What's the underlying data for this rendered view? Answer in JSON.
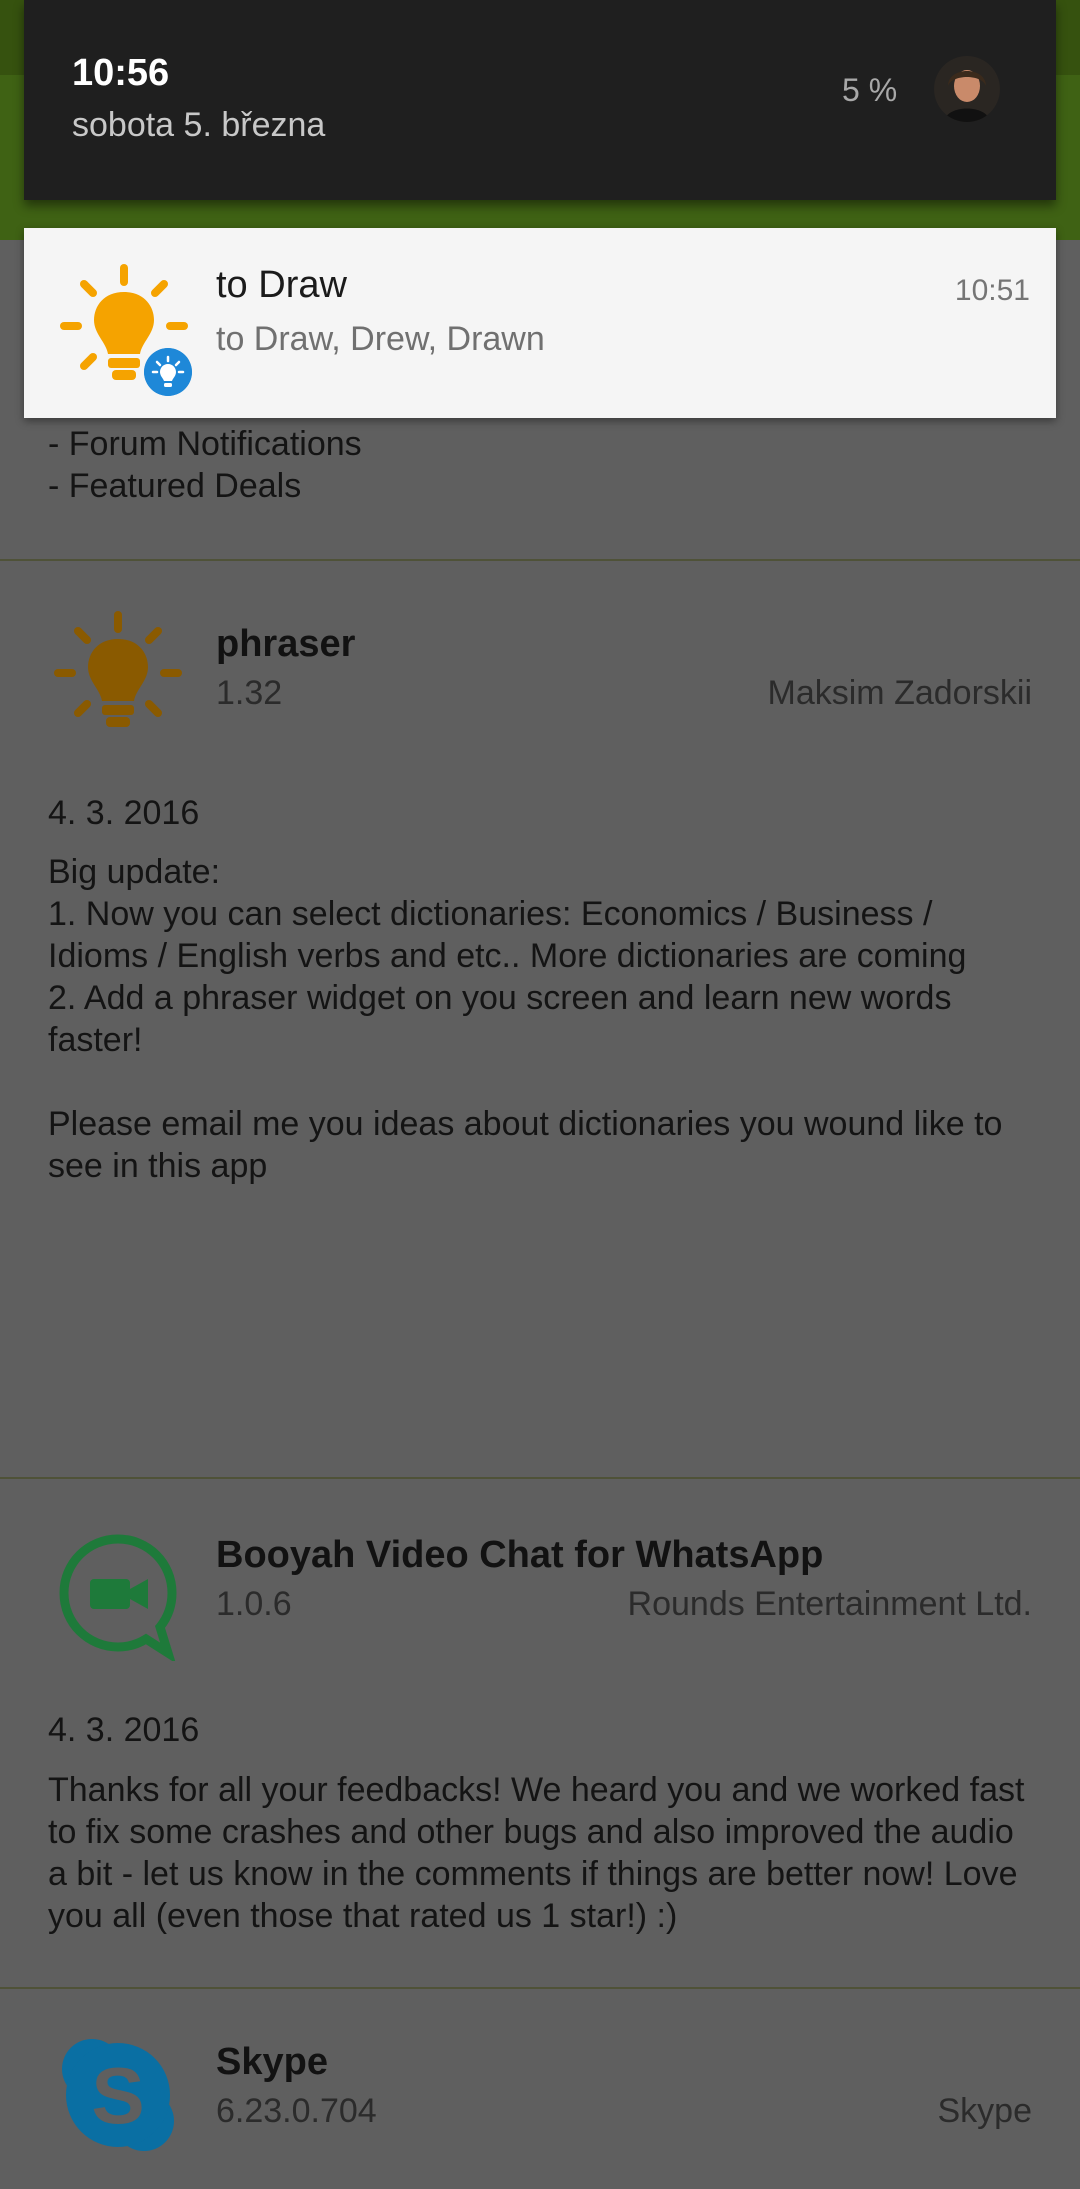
{
  "shade": {
    "time": "10:56",
    "date": "sobota 5. března",
    "battery": "5 %",
    "avatar_icon": "user-avatar"
  },
  "notification": {
    "icon": "lightbulb-icon",
    "badge_icon": "lightbulb-badge-icon",
    "title": "to Draw",
    "text": "to Draw, Drew, Drawn",
    "time": "10:51"
  },
  "previous_entry": {
    "lines": [
      "- Forum Notifications",
      "- Featured Deals"
    ]
  },
  "apps": [
    {
      "name": "phraser",
      "version": "1.32",
      "developer": "Maksim Zadorskii",
      "date": "4. 3. 2016",
      "notes": "Big update:\n1. Now you can select dictionaries: Economics / Business / Idioms / English verbs and etc.. More dictionaries are coming\n2. Add a phraser widget on you screen and learn new words faster!\n\nPlease email me you ideas about dictionaries you wound like to see in this app",
      "icon": "lightbulb-icon"
    },
    {
      "name": "Booyah Video Chat for WhatsApp",
      "version": "1.0.6",
      "developer": "Rounds Entertainment Ltd.",
      "date": "4. 3. 2016",
      "notes": "Thanks for all your feedbacks! We heard you and we worked fast to fix some crashes and other bugs and also improved the audio a bit - let us know in the comments if things are better now! Love you all (even those that rated us 1 star!) :)",
      "icon": "video-chat-icon"
    },
    {
      "name": "Skype",
      "version": "6.23.0.704",
      "developer": "Skype",
      "icon": "skype-icon"
    }
  ],
  "colors": {
    "scrim_background": "#5f5f5f",
    "appbar_green": "#3f6214",
    "lightbulb_orange": "#f5a300",
    "badge_blue": "#1e88d8",
    "booyah_green": "#1e7a3a",
    "skype_blue": "#0a6fa3"
  }
}
